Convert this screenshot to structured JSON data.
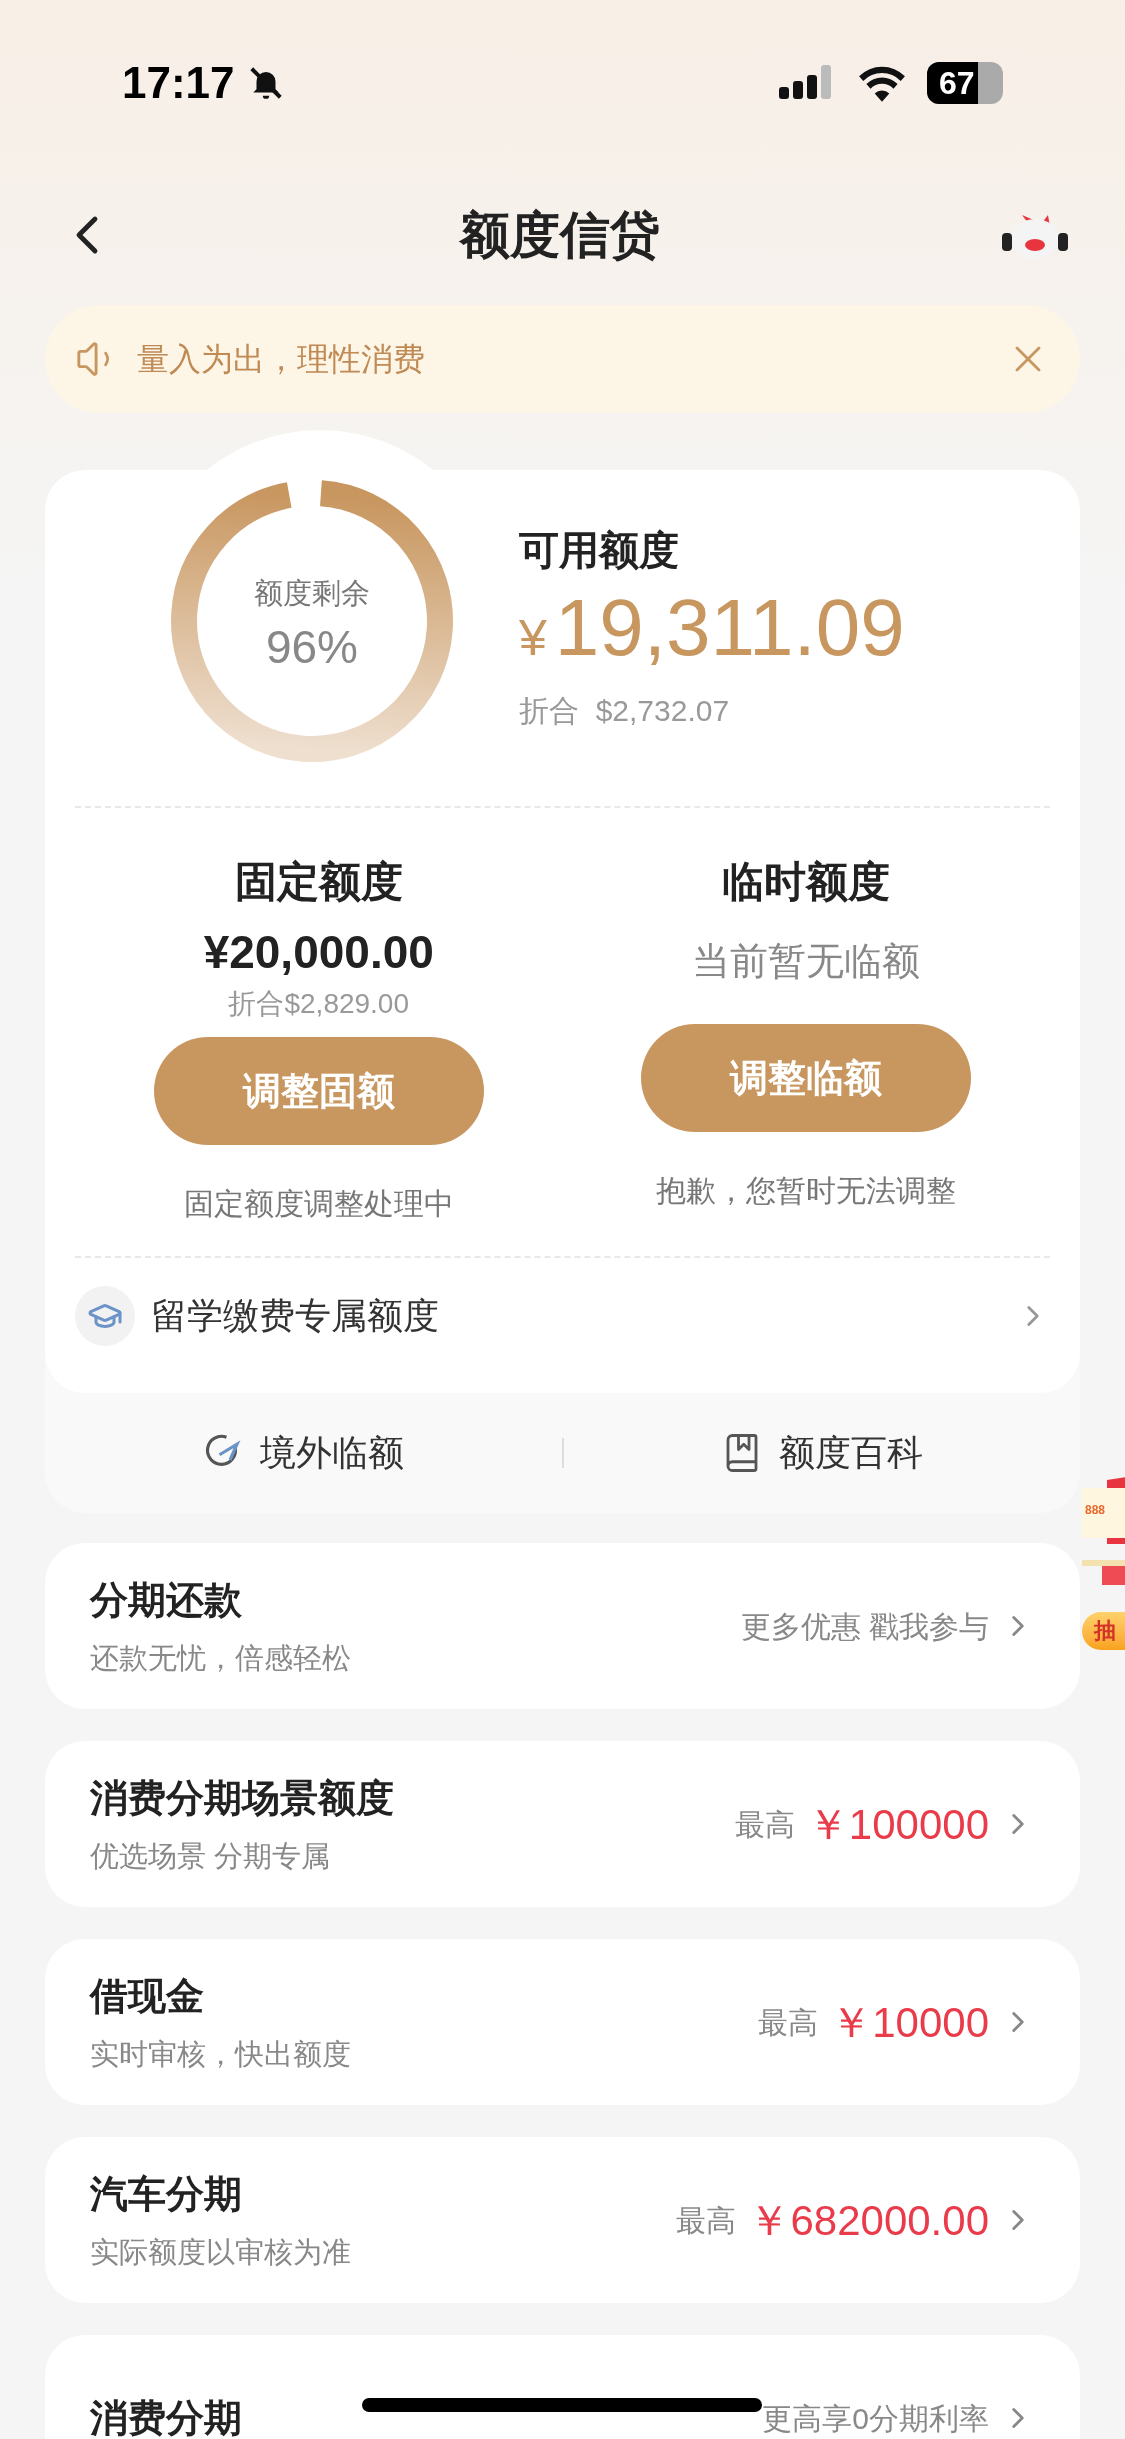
{
  "status_bar": {
    "time": "17:17",
    "battery": "67"
  },
  "nav": {
    "title": "额度信贷"
  },
  "notice": {
    "text": "量入为出，理性消费"
  },
  "quota": {
    "ring_label": "额度剩余",
    "ring_percent": "96%",
    "available_label": "可用额度",
    "currency": "¥",
    "available_amount": "19,311.09",
    "converted": "折合  $2,732.07"
  },
  "columns": [
    {
      "title": "固定额度",
      "amount": "¥20,000.00",
      "converted": "折合$2,829.00",
      "button": "调整固额",
      "caption": "固定额度调整处理中"
    },
    {
      "title": "临时额度",
      "status": "当前暂无临额",
      "button": "调整临额",
      "caption": "抱歉，您暂时无法调整"
    }
  ],
  "study_row": {
    "label": "留学缴费专属额度"
  },
  "links": [
    {
      "kind": "overseas",
      "label": "境外临额"
    },
    {
      "kind": "book",
      "label": "额度百科"
    }
  ],
  "promo": {
    "amount": "888",
    "button": "抽"
  },
  "cards": [
    {
      "title": "分期还款",
      "subtitle": "还款无忧，倍感轻松",
      "kind": "text",
      "right": "更多优惠 戳我参与"
    },
    {
      "title": "消费分期场景额度",
      "subtitle": "优选场景 分期专属",
      "kind": "max",
      "prefix": "最高",
      "right": "￥100000"
    },
    {
      "title": "借现金",
      "subtitle": "实时审核，快出额度",
      "kind": "max",
      "prefix": "最高",
      "right": "￥10000"
    },
    {
      "title": "汽车分期",
      "subtitle": "实际额度以审核为准",
      "kind": "max",
      "prefix": "最高",
      "right": "￥682000.00"
    },
    {
      "title": "消费分期",
      "kind": "text",
      "right": "更高享0分期利率"
    }
  ]
}
